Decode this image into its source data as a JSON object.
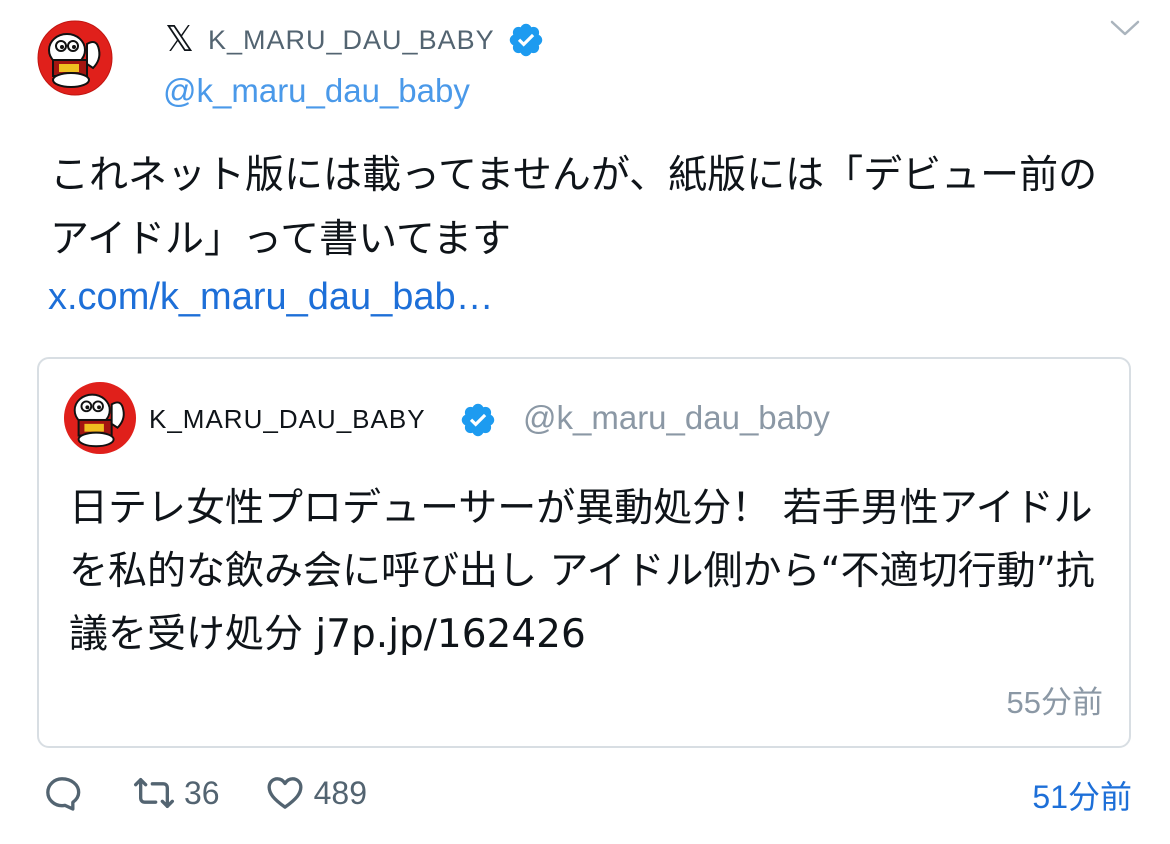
{
  "header": {
    "platform_logo": "𝕏",
    "display_name": "K_MARU_DAU_BABY",
    "handle": "@k_maru_dau_baby",
    "verified_icon": "verified-badge-icon",
    "menu_icon": "chevron-down-icon"
  },
  "tweet": {
    "text": "これネット版には載ってませんが、紙版には「デビュー前のアイドル」って書いてます",
    "link": "x.com/k_maru_dau_bab…"
  },
  "quote": {
    "display_name": "K_MARU_DAU_BABY",
    "handle": "@k_maru_dau_baby",
    "text": "日テレ女性プロデューサーが異動処分！ 若手男性アイドルを私的な飲み会に呼び出し アイドル側から“不適切行動”抗議を受け処分 j7p.jp/162426",
    "time": "55分前"
  },
  "actions": {
    "reply_icon": "reply-icon",
    "retweet_icon": "retweet-icon",
    "retweet_count": "36",
    "like_icon": "heart-icon",
    "like_count": "489"
  },
  "timestamp": "51分前",
  "colors": {
    "link_blue": "#1d6fd8",
    "handle_blue": "#4a99e9",
    "verified_blue": "#1d9bf0",
    "muted_gray": "#8b98a5",
    "avatar_red": "#e0201b"
  }
}
